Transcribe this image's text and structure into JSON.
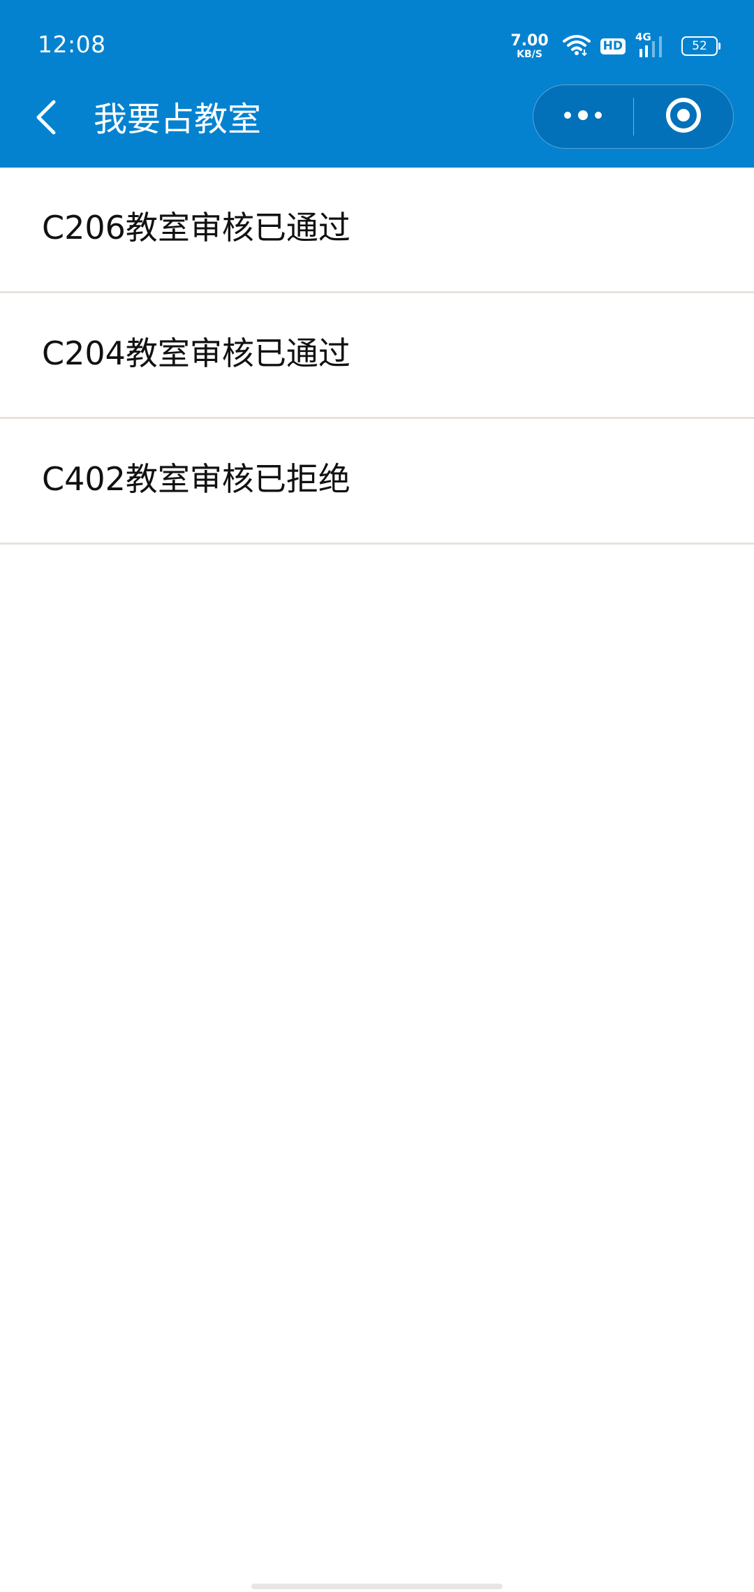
{
  "colors": {
    "header_bg": "#0482d0",
    "divider": "#e9e2da",
    "text": "#111111"
  },
  "status_bar": {
    "time": "12:08",
    "net_speed_value": "7.00",
    "net_speed_unit": "KB/S",
    "hd_badge": "HD",
    "network_type": "4G",
    "battery_level": "52",
    "icons": [
      "wifi-icon",
      "hd-icon",
      "signal-icon",
      "battery-icon"
    ]
  },
  "nav": {
    "title": "我要占教室",
    "back_icon": "chevron-left-icon",
    "more_icon": "more-dots-icon",
    "close_icon": "target-circle-icon"
  },
  "list": {
    "items": [
      {
        "text": "C206教室审核已通过"
      },
      {
        "text": "C204教室审核已通过"
      },
      {
        "text": "C402教室审核已拒绝"
      }
    ]
  }
}
